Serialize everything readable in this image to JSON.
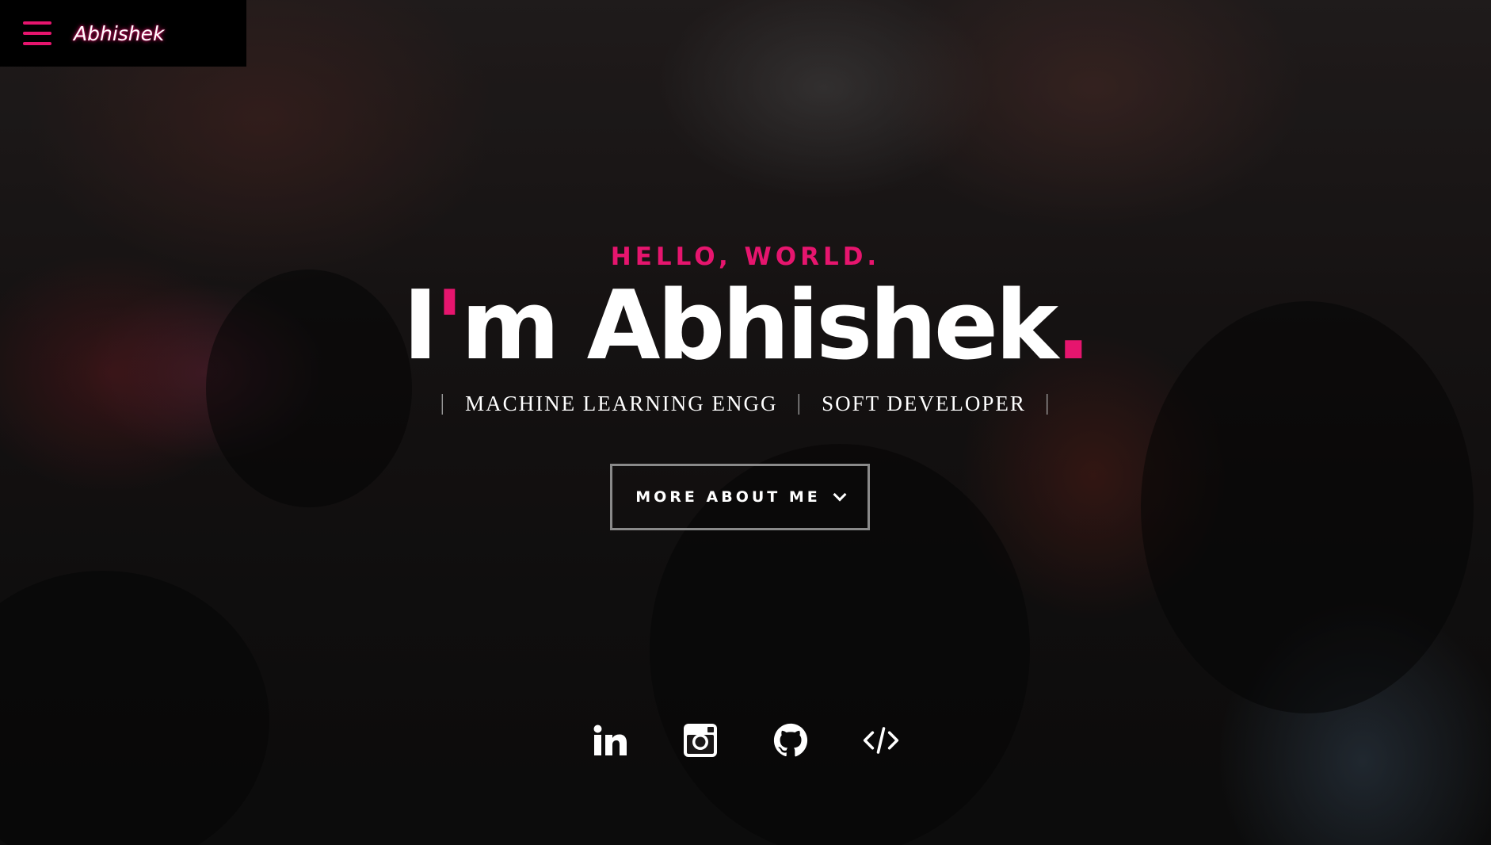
{
  "nav": {
    "menu_icon": "hamburger-menu-icon",
    "brand": "Abhishek"
  },
  "hero": {
    "greeting": "HELLO, WORLD.",
    "headline_prefix": "I",
    "headline_apostrophe": "'",
    "headline_main": "m Abhishek",
    "headline_dot": ".",
    "roles": [
      "MACHINE LEARNING ENGG",
      "SOFT DEVELOPER"
    ],
    "role_separator": "|",
    "cta_label": "MORE ABOUT ME",
    "cta_icon": "chevron-down-icon"
  },
  "socials": [
    {
      "icon": "linkedin-icon"
    },
    {
      "icon": "instagram-icon"
    },
    {
      "icon": "github-icon"
    },
    {
      "icon": "code-icon"
    }
  ],
  "colors": {
    "accent": "#e6156e",
    "text": "#ffffff",
    "topbar_bg": "#000000",
    "button_border": "#8a8a8a"
  }
}
